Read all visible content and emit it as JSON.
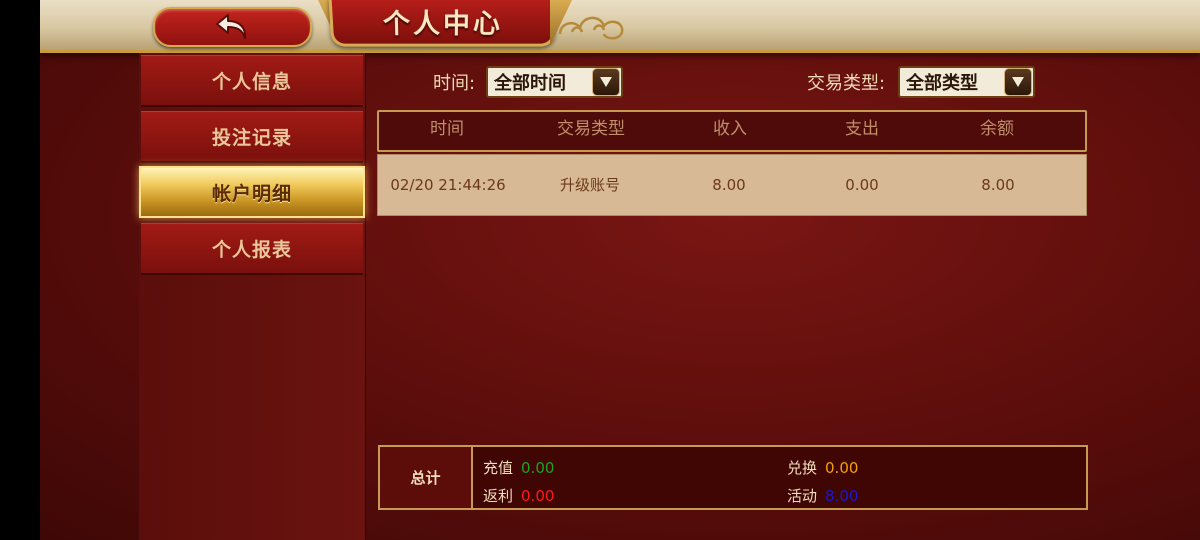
{
  "header": {
    "title": "个人中心",
    "back_icon": "back-arrow-icon"
  },
  "sidebar": {
    "items": [
      {
        "label": "个人信息",
        "active": false
      },
      {
        "label": "投注记录",
        "active": false
      },
      {
        "label": "帐户明细",
        "active": true
      },
      {
        "label": "个人报表",
        "active": false
      }
    ]
  },
  "filters": {
    "time_label": "时间:",
    "time_value": "全部时间",
    "type_label": "交易类型:",
    "type_value": "全部类型"
  },
  "table": {
    "columns": [
      "时间",
      "交易类型",
      "收入",
      "支出",
      "余额"
    ],
    "rows": [
      [
        "02/20 21:44:26",
        "升级账号",
        "8.00",
        "0.00",
        "8.00"
      ]
    ]
  },
  "summary": {
    "label": "总计",
    "recharge_label": "充值",
    "recharge_value": "0.00",
    "rebate_label": "返利",
    "rebate_value": "0.00",
    "exchange_label": "兑换",
    "exchange_value": "0.00",
    "activity_label": "活动",
    "activity_value": "8.00"
  },
  "colors": {
    "recharge": "#1fa31f",
    "rebate": "#ff1a1a",
    "exchange": "#f2a10a",
    "activity": "#1818d8"
  }
}
